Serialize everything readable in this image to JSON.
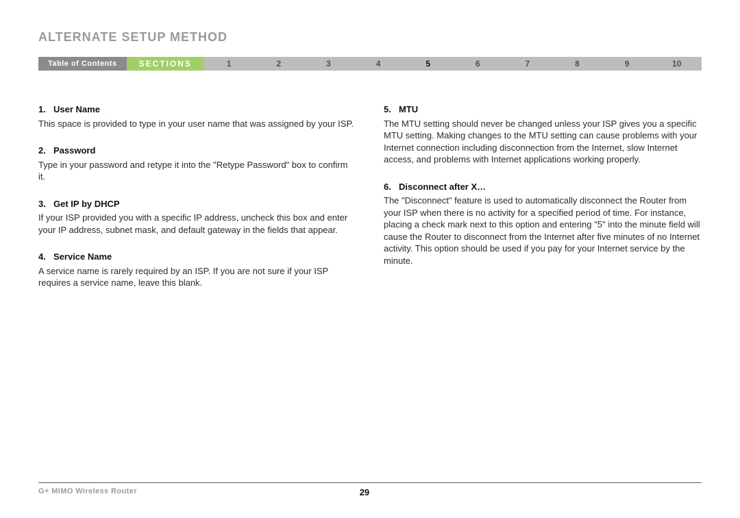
{
  "title": "ALTERNATE SETUP METHOD",
  "nav": {
    "toc": "Table of Contents",
    "sections_label": "SECTIONS",
    "numbers": [
      "1",
      "2",
      "3",
      "4",
      "5",
      "6",
      "7",
      "8",
      "9",
      "10"
    ],
    "active": "5"
  },
  "left": [
    {
      "num": "1.",
      "head": "User Name",
      "body": "This space is provided to type in your user name that was assigned by your ISP."
    },
    {
      "num": "2.",
      "head": "Password",
      "body": "Type in your password and retype it into the \"Retype Password\" box to confirm it."
    },
    {
      "num": "3.",
      "head": "Get IP by DHCP",
      "body": "If your ISP provided you with a specific IP address, uncheck this box and enter your IP address, subnet mask, and default gateway in the fields that appear."
    },
    {
      "num": "4.",
      "head": "Service Name",
      "body": "A service name is rarely required by an ISP. If you are not sure if your ISP requires a service name, leave this blank."
    }
  ],
  "right": [
    {
      "num": "5.",
      "head": "MTU",
      "body": "The MTU setting should never be changed unless your ISP gives you a specific MTU setting. Making changes to the MTU setting can cause problems with your Internet connection including disconnection from the Internet, slow Internet access, and problems with Internet applications working properly."
    },
    {
      "num": "6.",
      "head": "Disconnect after X…",
      "body": "The \"Disconnect\" feature is used to automatically disconnect the Router from your ISP when there is no activity for a specified period of time. For instance, placing a check mark next to this option and entering \"5\" into the minute field will cause the Router to disconnect from the Internet after five minutes of no Internet activity. This option should be used if you pay for your Internet service by the minute."
    }
  ],
  "footer": {
    "product": "G+ MIMO Wireless Router",
    "page": "29"
  }
}
